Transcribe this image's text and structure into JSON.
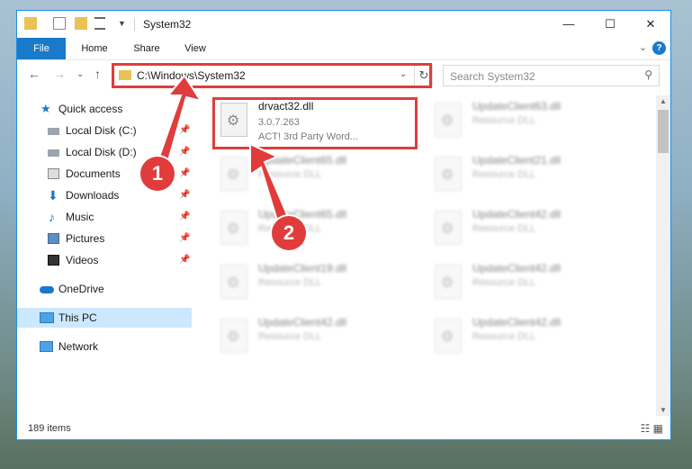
{
  "window": {
    "title": "System32",
    "controls": {
      "minimize": "—",
      "maximize": "☐",
      "close": "✕"
    }
  },
  "ribbon": {
    "tabs": [
      "File",
      "Home",
      "Share",
      "View"
    ],
    "collapse_icon": "⌄",
    "help": "?"
  },
  "address": {
    "path": "C:\\Windows\\System32",
    "dropdown": "⌄",
    "refresh": "↻"
  },
  "nav_buttons": {
    "back": "←",
    "forward": "→",
    "recent": "⌄",
    "up": "↑"
  },
  "search": {
    "placeholder": "Search System32",
    "icon": "⚲"
  },
  "navpane": {
    "items": [
      {
        "label": "Quick access",
        "icon": "star-icon",
        "pinned": false
      },
      {
        "label": "Local Disk (C:)",
        "icon": "drive-icon",
        "pinned": true
      },
      {
        "label": "Local Disk (D:)",
        "icon": "drive-icon",
        "pinned": true
      },
      {
        "label": "Documents",
        "icon": "documents-icon",
        "pinned": true
      },
      {
        "label": "Downloads",
        "icon": "download-icon",
        "pinned": true
      },
      {
        "label": "Music",
        "icon": "music-icon",
        "pinned": true
      },
      {
        "label": "Pictures",
        "icon": "pictures-icon",
        "pinned": true
      },
      {
        "label": "Videos",
        "icon": "videos-icon",
        "pinned": true
      },
      {
        "label": "OneDrive",
        "icon": "onedrive-icon",
        "pinned": false
      },
      {
        "label": "This PC",
        "icon": "pc-icon",
        "pinned": false
      },
      {
        "label": "Network",
        "icon": "network-icon",
        "pinned": false
      }
    ],
    "pin_glyph": "📌"
  },
  "files": [
    {
      "name": "drvact32.dll",
      "line2": "3.0.7.263",
      "line3": "ACT! 3rd Party Word..."
    },
    {
      "name": "UpdateClient63.dll",
      "line2": "Resource DLL"
    },
    {
      "name": "UpdateClient65.dll",
      "line2": "Resource DLL"
    },
    {
      "name": "UpdateClient21.dll",
      "line2": "Resource DLL"
    },
    {
      "name": "UpdateClient65.dll",
      "line2": "Resource DLL"
    },
    {
      "name": "UpdateClient42.dll",
      "line2": "Resource DLL"
    },
    {
      "name": "UpdateClient19.dll",
      "line2": "Resource DLL"
    },
    {
      "name": "UpdateClient42.dll",
      "line2": "Resource DLL"
    },
    {
      "name": "UpdateClient42.dll",
      "line2": "Resource DLL"
    },
    {
      "name": "UpdateClient42.dll",
      "line2": "Resource DLL"
    }
  ],
  "status": {
    "count": "189 items",
    "view_icons": "☷ ▦"
  },
  "annotations": {
    "badge1": "1",
    "badge2": "2",
    "color": "#e03c3c"
  },
  "colors": {
    "accent": "#1979ca",
    "selection": "#cce8ff",
    "highlight": "#e03c3c"
  }
}
